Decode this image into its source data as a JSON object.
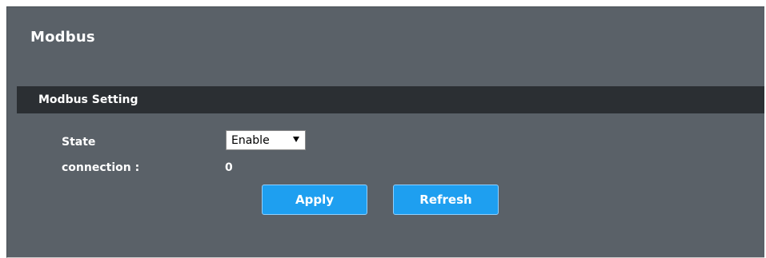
{
  "page": {
    "title": "Modbus"
  },
  "section": {
    "title": "Modbus Setting"
  },
  "fields": {
    "state_label": "State",
    "state_value": "Enable",
    "connection_label": "connection :",
    "connection_value": "0"
  },
  "buttons": {
    "apply_label": "Apply",
    "refresh_label": "Refresh"
  },
  "colors": {
    "panel_bg": "#5a6168",
    "section_header_bg": "#2b2f33",
    "button_bg": "#1e9ff0"
  },
  "icons": {
    "select_arrow": "chevron-down-icon"
  }
}
